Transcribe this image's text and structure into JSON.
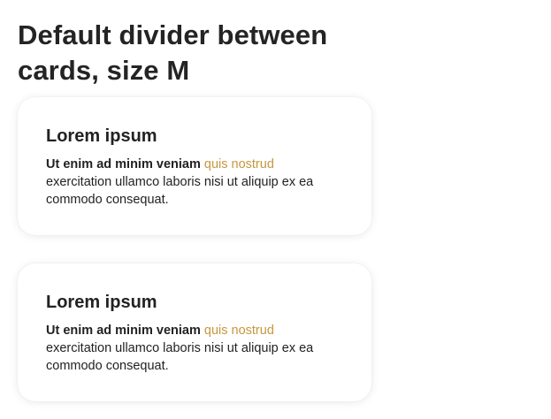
{
  "page": {
    "title": "Default divider between cards, size M"
  },
  "cards": [
    {
      "title": "Lorem ipsum",
      "bold_text": "Ut enim ad minim veniam",
      "link_text": "quis nostrud",
      "body_text": "exercitation ullamco laboris nisi ut aliquip ex ea commodo consequat."
    },
    {
      "title": "Lorem ipsum",
      "bold_text": "Ut enim ad minim veniam",
      "link_text": "quis nostrud",
      "body_text": "exercitation ullamco laboris nisi ut aliquip ex ea commodo consequat."
    }
  ],
  "colors": {
    "accent": "#c8963e",
    "text": "#222222"
  }
}
